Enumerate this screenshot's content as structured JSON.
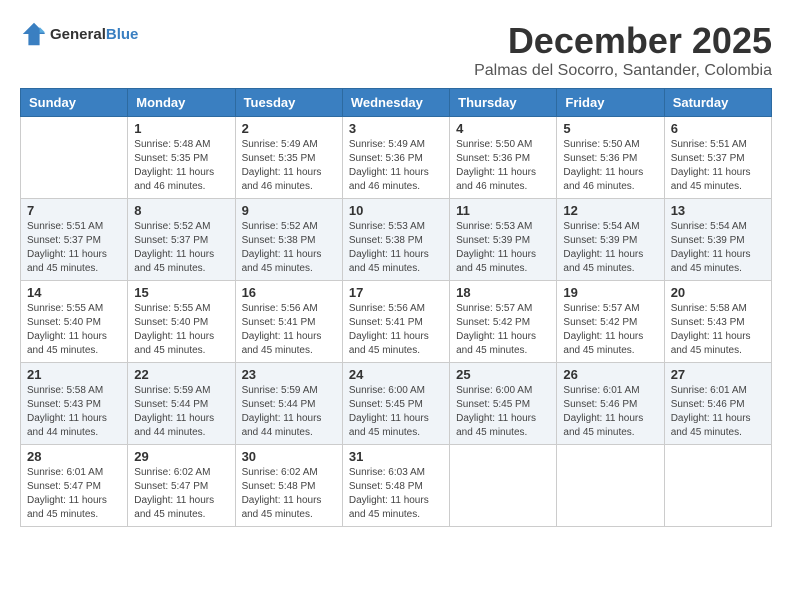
{
  "logo": {
    "general": "General",
    "blue": "Blue"
  },
  "title": "December 2025",
  "subtitle": "Palmas del Socorro, Santander, Colombia",
  "weekdays": [
    "Sunday",
    "Monday",
    "Tuesday",
    "Wednesday",
    "Thursday",
    "Friday",
    "Saturday"
  ],
  "weeks": [
    [
      {
        "day": "",
        "info": ""
      },
      {
        "day": "1",
        "info": "Sunrise: 5:48 AM\nSunset: 5:35 PM\nDaylight: 11 hours\nand 46 minutes."
      },
      {
        "day": "2",
        "info": "Sunrise: 5:49 AM\nSunset: 5:35 PM\nDaylight: 11 hours\nand 46 minutes."
      },
      {
        "day": "3",
        "info": "Sunrise: 5:49 AM\nSunset: 5:36 PM\nDaylight: 11 hours\nand 46 minutes."
      },
      {
        "day": "4",
        "info": "Sunrise: 5:50 AM\nSunset: 5:36 PM\nDaylight: 11 hours\nand 46 minutes."
      },
      {
        "day": "5",
        "info": "Sunrise: 5:50 AM\nSunset: 5:36 PM\nDaylight: 11 hours\nand 46 minutes."
      },
      {
        "day": "6",
        "info": "Sunrise: 5:51 AM\nSunset: 5:37 PM\nDaylight: 11 hours\nand 45 minutes."
      }
    ],
    [
      {
        "day": "7",
        "info": "Sunrise: 5:51 AM\nSunset: 5:37 PM\nDaylight: 11 hours\nand 45 minutes."
      },
      {
        "day": "8",
        "info": "Sunrise: 5:52 AM\nSunset: 5:37 PM\nDaylight: 11 hours\nand 45 minutes."
      },
      {
        "day": "9",
        "info": "Sunrise: 5:52 AM\nSunset: 5:38 PM\nDaylight: 11 hours\nand 45 minutes."
      },
      {
        "day": "10",
        "info": "Sunrise: 5:53 AM\nSunset: 5:38 PM\nDaylight: 11 hours\nand 45 minutes."
      },
      {
        "day": "11",
        "info": "Sunrise: 5:53 AM\nSunset: 5:39 PM\nDaylight: 11 hours\nand 45 minutes."
      },
      {
        "day": "12",
        "info": "Sunrise: 5:54 AM\nSunset: 5:39 PM\nDaylight: 11 hours\nand 45 minutes."
      },
      {
        "day": "13",
        "info": "Sunrise: 5:54 AM\nSunset: 5:39 PM\nDaylight: 11 hours\nand 45 minutes."
      }
    ],
    [
      {
        "day": "14",
        "info": "Sunrise: 5:55 AM\nSunset: 5:40 PM\nDaylight: 11 hours\nand 45 minutes."
      },
      {
        "day": "15",
        "info": "Sunrise: 5:55 AM\nSunset: 5:40 PM\nDaylight: 11 hours\nand 45 minutes."
      },
      {
        "day": "16",
        "info": "Sunrise: 5:56 AM\nSunset: 5:41 PM\nDaylight: 11 hours\nand 45 minutes."
      },
      {
        "day": "17",
        "info": "Sunrise: 5:56 AM\nSunset: 5:41 PM\nDaylight: 11 hours\nand 45 minutes."
      },
      {
        "day": "18",
        "info": "Sunrise: 5:57 AM\nSunset: 5:42 PM\nDaylight: 11 hours\nand 45 minutes."
      },
      {
        "day": "19",
        "info": "Sunrise: 5:57 AM\nSunset: 5:42 PM\nDaylight: 11 hours\nand 45 minutes."
      },
      {
        "day": "20",
        "info": "Sunrise: 5:58 AM\nSunset: 5:43 PM\nDaylight: 11 hours\nand 45 minutes."
      }
    ],
    [
      {
        "day": "21",
        "info": "Sunrise: 5:58 AM\nSunset: 5:43 PM\nDaylight: 11 hours\nand 44 minutes."
      },
      {
        "day": "22",
        "info": "Sunrise: 5:59 AM\nSunset: 5:44 PM\nDaylight: 11 hours\nand 44 minutes."
      },
      {
        "day": "23",
        "info": "Sunrise: 5:59 AM\nSunset: 5:44 PM\nDaylight: 11 hours\nand 44 minutes."
      },
      {
        "day": "24",
        "info": "Sunrise: 6:00 AM\nSunset: 5:45 PM\nDaylight: 11 hours\nand 45 minutes."
      },
      {
        "day": "25",
        "info": "Sunrise: 6:00 AM\nSunset: 5:45 PM\nDaylight: 11 hours\nand 45 minutes."
      },
      {
        "day": "26",
        "info": "Sunrise: 6:01 AM\nSunset: 5:46 PM\nDaylight: 11 hours\nand 45 minutes."
      },
      {
        "day": "27",
        "info": "Sunrise: 6:01 AM\nSunset: 5:46 PM\nDaylight: 11 hours\nand 45 minutes."
      }
    ],
    [
      {
        "day": "28",
        "info": "Sunrise: 6:01 AM\nSunset: 5:47 PM\nDaylight: 11 hours\nand 45 minutes."
      },
      {
        "day": "29",
        "info": "Sunrise: 6:02 AM\nSunset: 5:47 PM\nDaylight: 11 hours\nand 45 minutes."
      },
      {
        "day": "30",
        "info": "Sunrise: 6:02 AM\nSunset: 5:48 PM\nDaylight: 11 hours\nand 45 minutes."
      },
      {
        "day": "31",
        "info": "Sunrise: 6:03 AM\nSunset: 5:48 PM\nDaylight: 11 hours\nand 45 minutes."
      },
      {
        "day": "",
        "info": ""
      },
      {
        "day": "",
        "info": ""
      },
      {
        "day": "",
        "info": ""
      }
    ]
  ]
}
